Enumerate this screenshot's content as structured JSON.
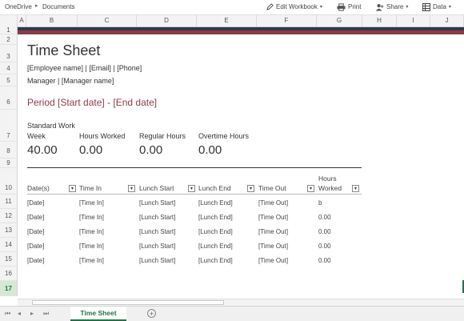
{
  "topbar": {
    "breadcrumb": [
      "OneDrive",
      "Documents"
    ],
    "edit_workbook": "Edit Workbook",
    "print": "Print",
    "share": "Share",
    "data": "Data"
  },
  "columns": [
    "A",
    "B",
    "C",
    "D",
    "E",
    "F",
    "G",
    "H",
    "I",
    "J"
  ],
  "rows": [
    "1",
    "2",
    "3",
    "4",
    "5",
    "6",
    "7",
    "8",
    "9",
    "10",
    "11",
    "12",
    "13",
    "14",
    "15",
    "16",
    "17"
  ],
  "sheet": {
    "title": "Time Sheet",
    "contact_line": "[Employee name] | [Email] | [Phone]",
    "manager_line": "Manager | [Manager name]",
    "period": "Period [Start date] - [End date]",
    "summary": {
      "standard_label_1": "Standard Work",
      "standard_label_2": "Week",
      "standard_value": "40.00",
      "hours_worked_label": "Hours Worked",
      "hours_worked_value": "0.00",
      "regular_label": "Regular Hours",
      "regular_value": "0.00",
      "overtime_label": "Overtime Hours",
      "overtime_value": "0.00"
    },
    "table": {
      "headers": [
        "Date(s)",
        "Time In",
        "Lunch Start",
        "Lunch End",
        "Time Out"
      ],
      "hours_header_1": "Hours",
      "hours_header_2": "Worked",
      "rows": [
        [
          "[Date]",
          "[Time In]",
          "[Lunch Start]",
          "[Lunch End]",
          "[Time Out]",
          "b"
        ],
        [
          "[Date]",
          "[Time In]",
          "[Lunch Start]",
          "[Lunch End]",
          "[Time Out]",
          "0.00"
        ],
        [
          "[Date]",
          "[Time In]",
          "[Lunch Start]",
          "[Lunch End]",
          "[Time Out]",
          "0.00"
        ],
        [
          "[Date]",
          "[Time In]",
          "[Lunch Start]",
          "[Lunch End]",
          "[Time Out]",
          "0.00"
        ],
        [
          "[Date]",
          "[Time In]",
          "[Lunch Start]",
          "[Lunch End]",
          "[Time Out]",
          "0.00"
        ]
      ]
    }
  },
  "tabs": {
    "active": "Time Sheet",
    "add_symbol": "+"
  },
  "colors": {
    "accent": "#217346",
    "band_dark": "#2f3a4a",
    "band_red": "#8a3b44",
    "period_text": "#8f3c44"
  }
}
